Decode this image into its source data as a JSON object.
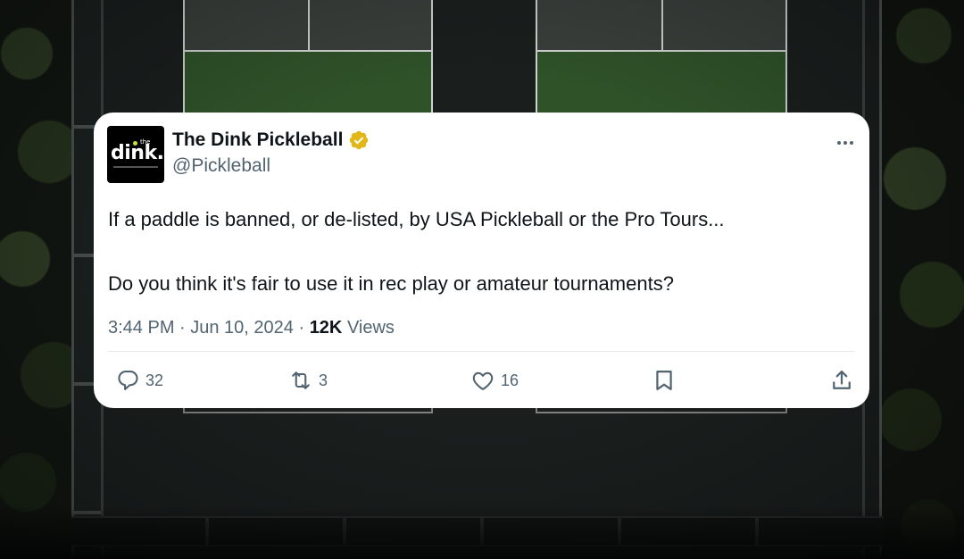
{
  "tweet": {
    "display_name": "The Dink Pickleball",
    "handle": "@Pickleball",
    "avatar_text": {
      "small": "the",
      "main": "dink."
    },
    "text_line_1": "If a paddle is banned, or de-listed, by USA Pickleball or the Pro Tours...",
    "text_line_2": "Do you think it's fair to use it in rec play or amateur tournaments?",
    "timestamp": "3:44 PM · Jun 10, 2024 · ",
    "views_count": "12K",
    "views_label": " Views",
    "replies": "32",
    "retweets": "3",
    "likes": "16"
  },
  "icons": [
    "verified-badge-icon",
    "more-icon",
    "reply-icon",
    "retweet-icon",
    "like-icon",
    "bookmark-icon",
    "share-icon"
  ],
  "colors": {
    "text_primary": "#0f1419",
    "text_secondary": "#536471",
    "verified_gold": "#e2b719",
    "card_bg": "#ffffff",
    "court_green": "#2f5229"
  }
}
